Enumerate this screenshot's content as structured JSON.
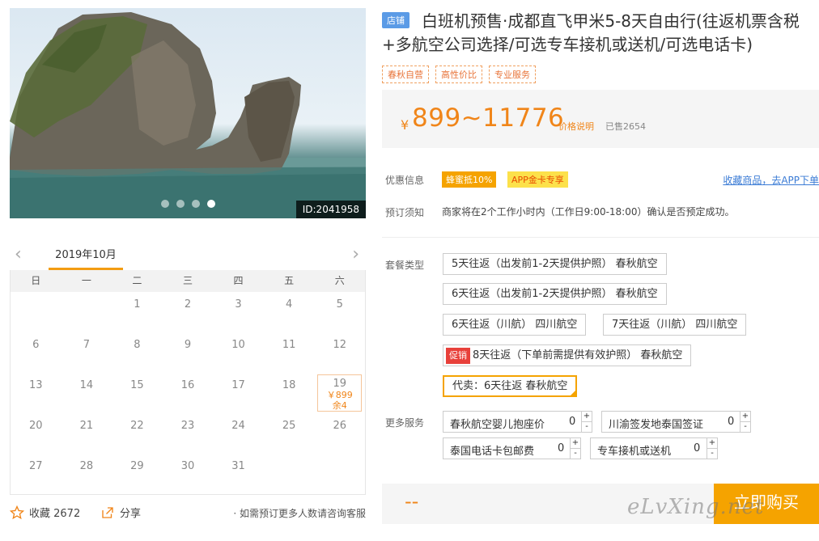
{
  "hero": {
    "image_id": "ID:2041958",
    "slides": 4,
    "active_slide": 4
  },
  "calendar": {
    "month": "2019年10月",
    "weekdays": [
      "日",
      "一",
      "二",
      "三",
      "四",
      "五",
      "六"
    ],
    "days": [
      {
        "d": ""
      },
      {
        "d": ""
      },
      {
        "d": "1"
      },
      {
        "d": "2"
      },
      {
        "d": "3"
      },
      {
        "d": "4"
      },
      {
        "d": "5"
      },
      {
        "d": "6"
      },
      {
        "d": "7"
      },
      {
        "d": "8"
      },
      {
        "d": "9"
      },
      {
        "d": "10"
      },
      {
        "d": "11"
      },
      {
        "d": "12"
      },
      {
        "d": "13"
      },
      {
        "d": "14"
      },
      {
        "d": "15"
      },
      {
        "d": "16"
      },
      {
        "d": "17"
      },
      {
        "d": "18"
      },
      {
        "d": "19",
        "price": "￥899",
        "remain": "余4"
      },
      {
        "d": "20"
      },
      {
        "d": "21"
      },
      {
        "d": "22"
      },
      {
        "d": "23"
      },
      {
        "d": "24"
      },
      {
        "d": "25"
      },
      {
        "d": "26"
      },
      {
        "d": "27"
      },
      {
        "d": "28"
      },
      {
        "d": "29"
      },
      {
        "d": "30"
      },
      {
        "d": "31"
      },
      {
        "d": ""
      },
      {
        "d": ""
      }
    ]
  },
  "bottom": {
    "favorite_label": "收藏 2672",
    "share_label": "分享",
    "tip": "· 如需预订更多人数请咨询客服"
  },
  "product": {
    "store_badge": "店铺",
    "title": "白班机预售·成都直飞甲米5-8天自由行(往返机票含税+多航空公司选择/可选专车接机或送机/可选电话卡)",
    "tags": [
      "春秋自营",
      "高性价比",
      "专业服务"
    ]
  },
  "price": {
    "currency": "¥",
    "amount": "899~11776",
    "desc_link": "价格说明",
    "sold": "已售2654"
  },
  "promo": {
    "label": "优惠信息",
    "badges": [
      "蜂蜜抵10%",
      "APP金卡专享"
    ],
    "collect_link": "收藏商品，去APP下单"
  },
  "notice": {
    "label": "预订须知",
    "text": "商家将在2个工作小时内（工作日9:00-18:00）确认是否预定成功。"
  },
  "packages": {
    "label": "套餐类型",
    "items": [
      {
        "text": "5天往返（出发前1-2天提供护照） 春秋航空"
      },
      {
        "text": "6天往返（出发前1-2天提供护照） 春秋航空"
      },
      {
        "text": "6天往返（川航） 四川航空"
      },
      {
        "text": "7天往返（川航） 四川航空"
      },
      {
        "text": "8天往返（下单前需提供有效护照） 春秋航空",
        "promo": "促销"
      },
      {
        "text": "代卖：6天往返 春秋航空",
        "selected": true
      }
    ]
  },
  "services": {
    "label": "更多服务",
    "items": [
      {
        "name": "春秋航空婴儿抱座价",
        "qty": "0"
      },
      {
        "name": "川渝签发地泰国签证",
        "qty": "0"
      },
      {
        "name": "泰国电话卡包邮费",
        "qty": "0"
      },
      {
        "name": "专车接机或送机",
        "qty": "0"
      }
    ],
    "plus": "+",
    "minus": "-"
  },
  "buy": {
    "price_placeholder": "--",
    "button": "立即购买"
  },
  "watermark": "eLvXing.net",
  "colors": {
    "accent": "#f08519",
    "button": "#f5a300",
    "link": "#3a7bd5",
    "store_badge": "#5b9be6"
  }
}
